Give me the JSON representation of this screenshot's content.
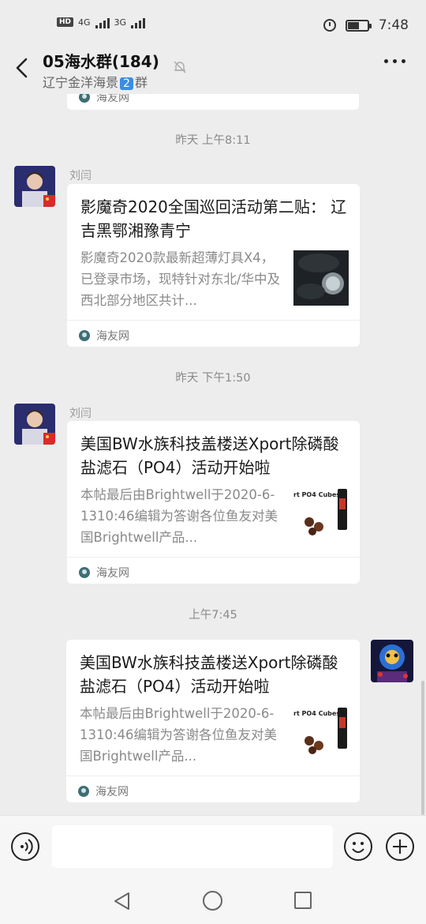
{
  "status_bar": {
    "left_badge": "HD",
    "net1": "4G",
    "net2": "3G",
    "time": "7:48",
    "battery_level": 0.6
  },
  "header": {
    "title": "05海水群(184)",
    "subtitle_prefix": "辽宁金洋海景",
    "subtitle_badge": "2",
    "subtitle_suffix": "群"
  },
  "messages": [
    {
      "type": "timestamp",
      "text": "昨天 上午8:11"
    },
    {
      "type": "card",
      "side": "left",
      "sender": "刘闫",
      "title": "影魔奇2020全国巡回活动第二贴： 辽吉黑鄂湘豫青宁",
      "desc": "影魔奇2020款最新超薄灯具X4，已登录市场，现特针对东北/华中及西北部分地区共计...",
      "source": "海友网"
    },
    {
      "type": "timestamp",
      "text": "昨天 下午1:50"
    },
    {
      "type": "card",
      "side": "left",
      "sender": "刘闫",
      "title": "美国BW水族科技盖楼送Xport除磷酸盐滤石（PO4）活动开始啦",
      "desc": "本帖最后由Brightwell于2020-6-1310:46编辑为答谢各位鱼友对美国Brightwell产品...",
      "source": "海友网",
      "thumb_text": "rt PO4 Cubes"
    },
    {
      "type": "timestamp",
      "text": "上午7:45"
    },
    {
      "type": "card",
      "side": "right",
      "title": "美国BW水族科技盖楼送Xport除磷酸盐滤石（PO4）活动开始啦",
      "desc": "本帖最后由Brightwell于2020-6-1310:46编辑为答谢各位鱼友对美国Brightwell产品...",
      "source": "海友网",
      "thumb_text": "rt PO4 Cubes"
    }
  ],
  "top_partial_source": "海友网",
  "icons": {
    "back": "chevron-left-icon",
    "mute": "bell-off-icon",
    "more": "more-dots-icon",
    "voice": "voice-icon",
    "emoji": "emoji-icon",
    "plus": "plus-icon"
  }
}
